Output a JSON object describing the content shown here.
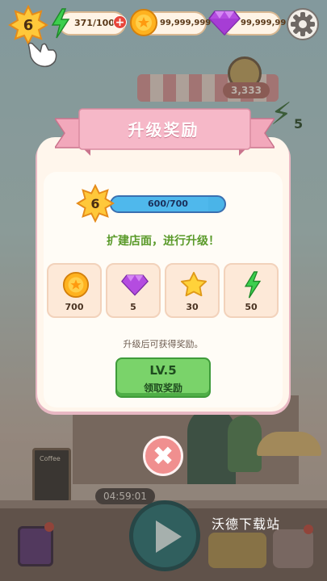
{
  "hud": {
    "level": "6",
    "energy": "371/100",
    "energy_plus": "+",
    "coins": "99,999,999",
    "gems": "99,999,99"
  },
  "background": {
    "badge_value": "3,333",
    "energy_side_value": "5",
    "timer": "04:59:01",
    "sign_text": "Coffee"
  },
  "modal": {
    "title": "升级奖励",
    "level": "6",
    "xp_text": "600/700",
    "xp_progress": 0.857,
    "subtitle": "扩建店面，进行升级！",
    "rewards": [
      {
        "icon": "coin-icon",
        "value": "700"
      },
      {
        "icon": "gem-icon",
        "value": "5"
      },
      {
        "icon": "star-icon",
        "value": "30"
      },
      {
        "icon": "lightning-icon",
        "value": "50"
      }
    ],
    "note": "升级后可获得奖励。",
    "claim_level": "LV.5",
    "claim_label": "领取奖励",
    "close": "✖"
  },
  "watermark": "沃德下载站",
  "colors": {
    "ribbon": "#f2a8bb",
    "claim_button": "#7ad36a",
    "close_button": "#f08f8f",
    "xp_bar": "#4ab4e8"
  }
}
